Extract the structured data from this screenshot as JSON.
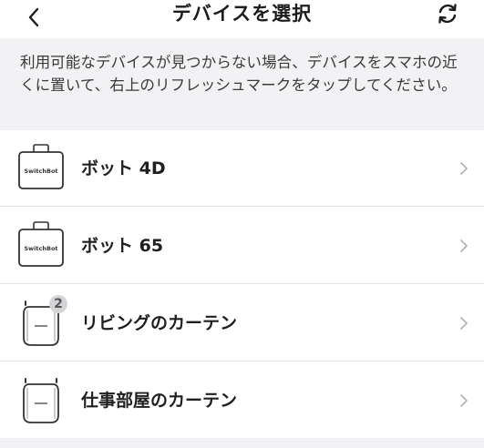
{
  "header": {
    "title": "デバイスを選択",
    "back_icon": "chevron-left-icon",
    "refresh_icon": "refresh-icon"
  },
  "notice": {
    "text": "利用可能なデバイスが見つからない場合、デバイスをスマホの近くに置いて、右上のリフレッシュマークをタップしてください。"
  },
  "devices": [
    {
      "label": "ボット 4D",
      "icon": "bot-device-icon",
      "icon_text": "SwitchBot",
      "badge": ""
    },
    {
      "label": "ボット 65",
      "icon": "bot-device-icon",
      "icon_text": "SwitchBot",
      "badge": ""
    },
    {
      "label": "リビングのカーテン",
      "icon": "curtain-device-icon",
      "icon_text": "",
      "badge": "2"
    },
    {
      "label": "仕事部屋のカーテン",
      "icon": "curtain-device-icon",
      "icon_text": "",
      "badge": ""
    }
  ],
  "colors": {
    "background": "#f2f2f4",
    "surface": "#ffffff",
    "text": "#1f1f1f",
    "divider": "#e2e2e4",
    "chevron": "#b0b0b4"
  }
}
